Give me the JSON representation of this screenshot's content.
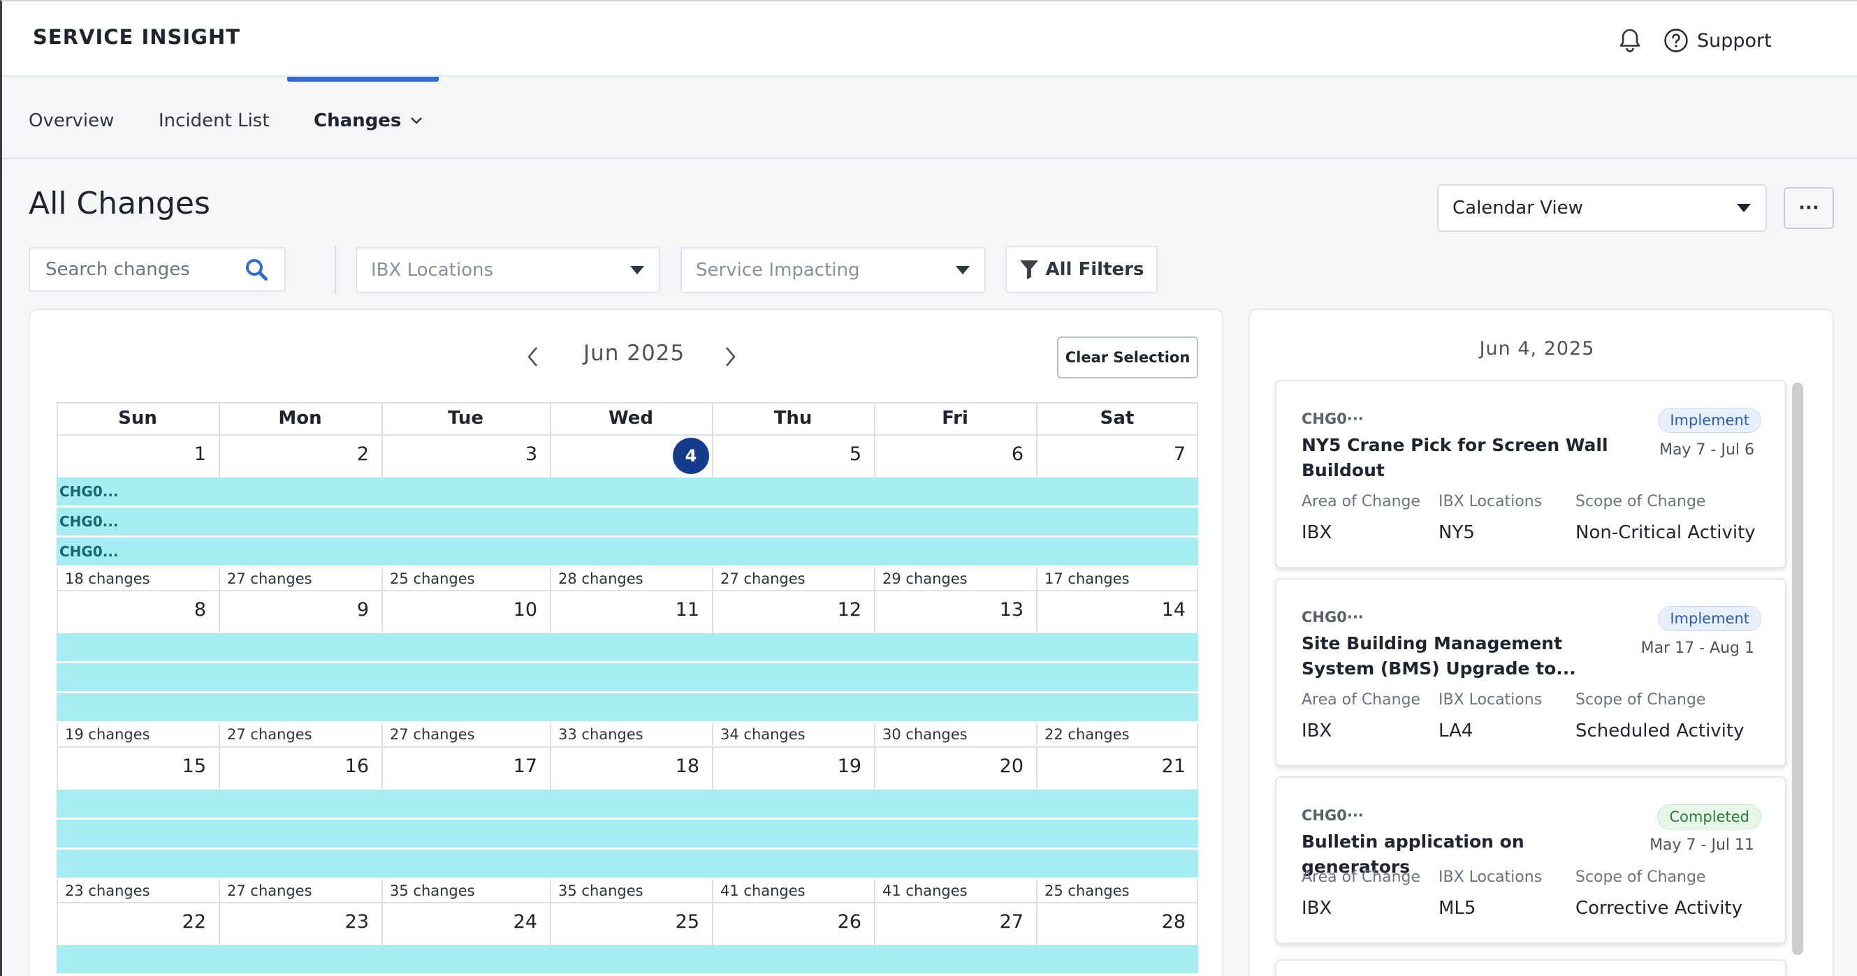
{
  "header": {
    "app_title": "SERVICE INSIGHT",
    "support_label": "Support"
  },
  "nav": {
    "tabs": [
      {
        "label": "Overview"
      },
      {
        "label": "Incident List"
      },
      {
        "label": "Changes",
        "active": true
      }
    ]
  },
  "page": {
    "title": "All Changes",
    "view_select": "Calendar View",
    "more_label": "···"
  },
  "filters": {
    "search_placeholder": "Search changes",
    "ibx_locations_placeholder": "IBX Locations",
    "service_impacting_placeholder": "Service Impacting",
    "all_filters_label": "All Filters"
  },
  "calendar": {
    "month_label": "Jun 2025",
    "clear_selection_label": "Clear Selection",
    "weekdays": [
      "Sun",
      "Mon",
      "Tue",
      "Wed",
      "Thu",
      "Fri",
      "Sat"
    ],
    "selected_day": 4,
    "weeks": [
      {
        "days": [
          "1",
          "2",
          "3",
          "4",
          "5",
          "6",
          "7"
        ],
        "bands": [
          "CHG0...",
          "CHG0...",
          "CHG0..."
        ],
        "counts": [
          "18 changes",
          "27 changes",
          "25 changes",
          "28 changes",
          "27 changes",
          "29 changes",
          "17 changes"
        ]
      },
      {
        "days": [
          "8",
          "9",
          "10",
          "11",
          "12",
          "13",
          "14"
        ],
        "bands": [
          "",
          "",
          ""
        ],
        "counts": [
          "19 changes",
          "27 changes",
          "27 changes",
          "33 changes",
          "34 changes",
          "30 changes",
          "22 changes"
        ]
      },
      {
        "days": [
          "15",
          "16",
          "17",
          "18",
          "19",
          "20",
          "21"
        ],
        "bands": [
          "",
          "",
          ""
        ],
        "counts": [
          "23 changes",
          "27 changes",
          "35 changes",
          "35 changes",
          "41 changes",
          "41 changes",
          "25 changes"
        ]
      },
      {
        "days": [
          "22",
          "23",
          "24",
          "25",
          "26",
          "27",
          "28"
        ],
        "bands": [
          ""
        ],
        "counts": []
      }
    ],
    "band_color": "#a6ecf3",
    "today_color": "#133c8c"
  },
  "side_panel": {
    "selected_date": "Jun 4, 2025",
    "field_labels": {
      "area": "Area of Change",
      "ibx": "IBX Locations",
      "scope": "Scope of Change"
    },
    "cards": [
      {
        "id": "CHG0···",
        "title": "NY5 Crane Pick for Screen Wall Buildout",
        "status": "Implement",
        "dates": "May 7 - Jul 6",
        "area": "IBX",
        "ibx": "NY5",
        "scope": "Non-Critical Activity"
      },
      {
        "id": "CHG0···",
        "title": "Site Building Management System (BMS) Upgrade to...",
        "status": "Implement",
        "dates": "Mar 17 - Aug 1",
        "area": "IBX",
        "ibx": "LA4",
        "scope": "Scheduled Activity"
      },
      {
        "id": "CHG0···",
        "title": "Bulletin application on generators",
        "status": "Completed",
        "dates": "May 7 - Jul 11",
        "area": "IBX",
        "ibx": "ML5",
        "scope": "Corrective Activity"
      }
    ]
  }
}
